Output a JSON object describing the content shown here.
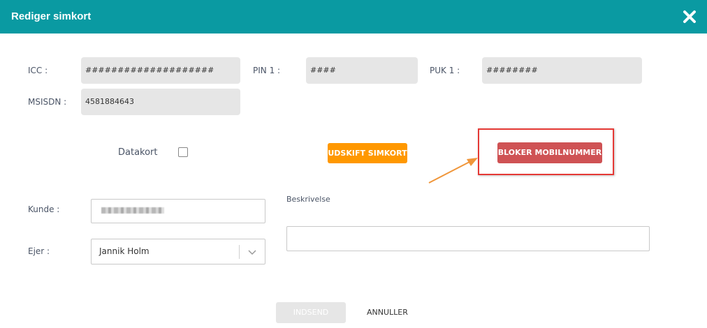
{
  "dialog": {
    "title": "Rediger simkort",
    "close_icon": "close-icon"
  },
  "fields": {
    "icc_label": "ICC :",
    "icc_value": "####################",
    "pin1_label": "PIN 1 :",
    "pin1_value": "####",
    "puk1_label": "PUK 1 :",
    "puk1_value": "########",
    "msisdn_label": "MSISDN :",
    "msisdn_value": "4581884643"
  },
  "datakort": {
    "label": "Datakort",
    "checked": false
  },
  "actions": {
    "replace_sim": "UDSKIFT SIMKORT",
    "block_number": "BLOKER MOBILNUMMER"
  },
  "customer": {
    "kunde_label": "Kunde :",
    "ejer_label": "Ejer :",
    "ejer_value": "Jannik Holm",
    "ejer_icon": "chevron-down-icon"
  },
  "description": {
    "label": "Beskrivelse",
    "value": ""
  },
  "footer": {
    "submit": "INDSEND",
    "cancel": "ANNULLER"
  },
  "colors": {
    "header": "#0a9aa2",
    "orange": "#ff9800",
    "red": "#cf5254",
    "highlight": "#e53935",
    "arrow": "#f0963a"
  }
}
